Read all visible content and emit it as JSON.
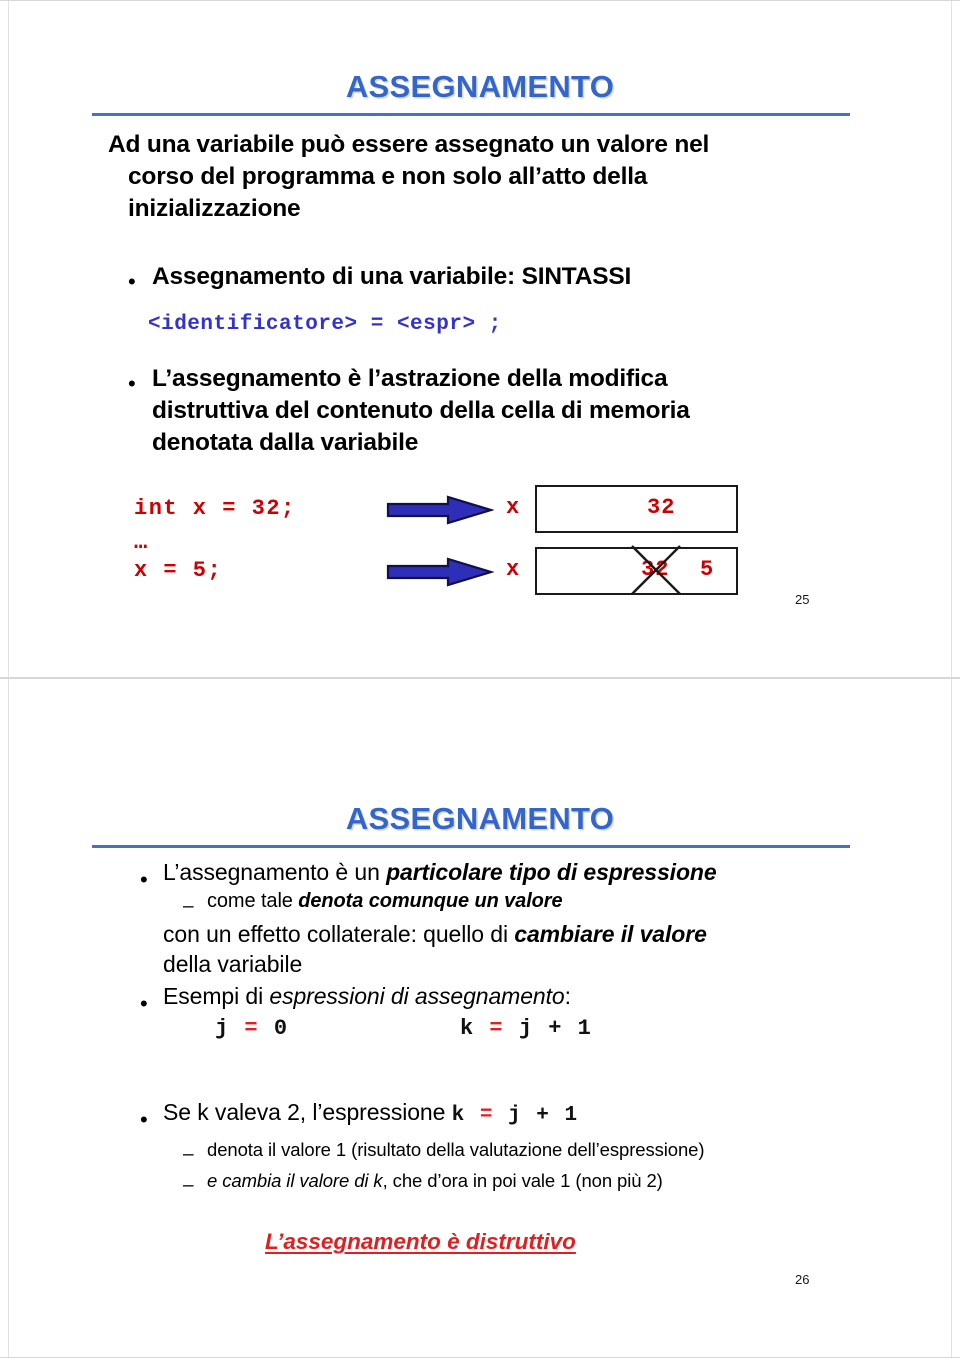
{
  "document": {
    "kind": "lecture-slides-handout",
    "language": "it"
  },
  "slides": [
    {
      "number": "25",
      "title": "ASSEGNAMENTO",
      "lead_lines": [
        "Ad una variabile può essere assegnato un valore nel",
        "corso del programma e non solo all’atto della",
        "inizializzazione"
      ],
      "bullet_1": {
        "marker": "•",
        "text": "Assegnamento di una variabile: SINTASSI"
      },
      "syntax": "<identificatore> = <espr> ;",
      "bullet_2": {
        "marker": "•",
        "lines": [
          "L’assegnamento è l’astrazione della modifica",
          "distruttiva del contenuto della cella di memoria",
          "denotata dalla variabile"
        ]
      },
      "diagram": {
        "rows": [
          {
            "code": "int x = 32;",
            "arrow": "right-arrow-icon",
            "cell_label": "x",
            "cell_value": "32",
            "struck_value": "",
            "crossed_out": false
          },
          {
            "code": "x = 5;",
            "arrow": "right-arrow-icon",
            "cell_label": "x",
            "cell_value": "5",
            "struck_value": "32",
            "crossed_out": true
          }
        ],
        "ellipsis": "…"
      }
    },
    {
      "number": "26",
      "title": "ASSEGNAMENTO",
      "bullet_1": {
        "marker": "•",
        "plain_a": "L’assegnamento è un ",
        "emph_a": "particolare tipo di espressione"
      },
      "sub_1": {
        "marker": "–",
        "plain_a": "come tale ",
        "emph_a": "denota comunque un valore"
      },
      "cont_lines": {
        "line1_plain": "con un effetto collaterale: quello di ",
        "line1_emph": "cambiare il valore",
        "line2_plain": "della variabile"
      },
      "bullet_2": {
        "marker": "•",
        "plain_a": "Esempi di ",
        "emph_a": "espressioni di assegnamento",
        "plain_b": ":"
      },
      "examples": {
        "left": {
          "lhs": "j",
          "op": "=",
          "rhs": "0"
        },
        "right": {
          "lhs": "k",
          "op": "=",
          "rhs": "j + 1"
        }
      },
      "bullet_3": {
        "marker": "•",
        "plain_a": "Se k valeva 2, l’espressione ",
        "code_lhs": "k",
        "code_op": "=",
        "code_rhs": "j + 1"
      },
      "sub_2": {
        "marker": "–",
        "text": "denota il valore 1 (risultato della valutazione dell’espressione)"
      },
      "sub_3": {
        "marker": "–",
        "emph_a": "e cambia il valore di k",
        "plain_a": ", che d’ora in poi vale 1 (non più 2)"
      },
      "closing": "L’assegnamento è distruttivo"
    }
  ],
  "colors": {
    "title_blue": "#3366CC",
    "rule_blue": "#4472C4",
    "code_blue": "#3333CC",
    "code_red": "#CC0000",
    "accent_red": "#E02020",
    "arrow_blue": "#2E2EB8",
    "ink": "#000000"
  }
}
